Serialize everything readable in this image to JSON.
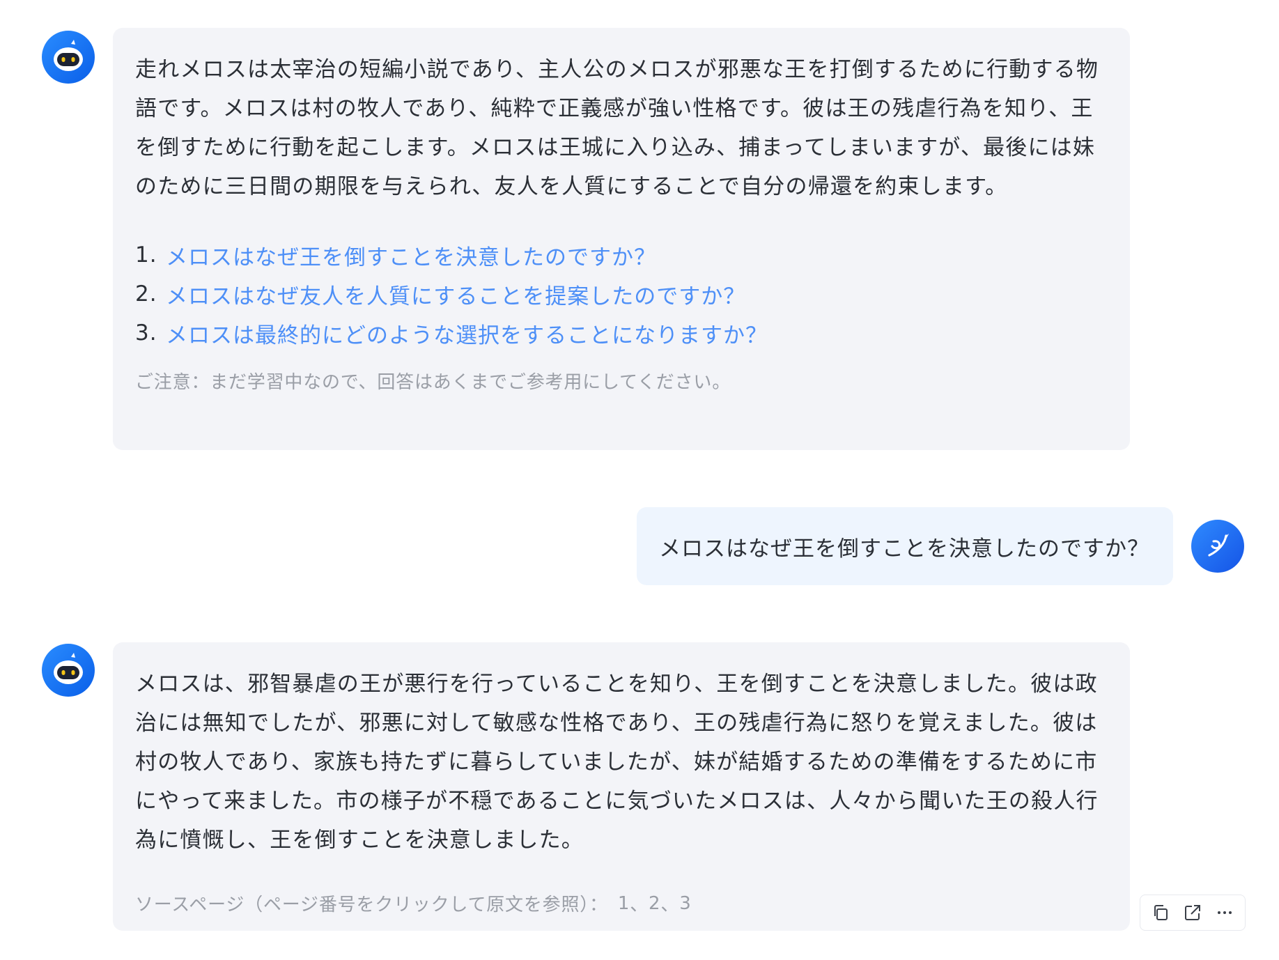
{
  "messages": {
    "bot1": {
      "paragraph": "走れメロスは太宰治の短編小説であり、主人公のメロスが邪悪な王を打倒するために行動する物語です。メロスは村の牧人であり、純粋で正義感が強い性格です。彼は王の残虐行為を知り、王を倒すために行動を起こします。メロスは王城に入り込み、捕まってしまいますが、最後には妹のために三日間の期限を与えられ、友人を人質にすることで自分の帰還を約束します。",
      "suggestions": [
        {
          "num": "1.",
          "text": "メロスはなぜ王を倒すことを決意したのですか？"
        },
        {
          "num": "2.",
          "text": "メロスはなぜ友人を人質にすることを提案したのですか？"
        },
        {
          "num": "3.",
          "text": "メロスは最終的にどのような選択をすることになりますか？"
        }
      ],
      "note": "ご注意：まだ学習中なので、回答はあくまでご参考用にしてください。"
    },
    "user1": {
      "text": "メロスはなぜ王を倒すことを決意したのですか？"
    },
    "bot2": {
      "paragraph": "メロスは、邪智暴虐の王が悪行を行っていることを知り、王を倒すことを決意しました。彼は政治には無知でしたが、邪悪に対して敏感な性格であり、王の残虐行為に怒りを覚えました。彼は村の牧人であり、家族も持たずに暮らしていましたが、妹が結婚するための準備をするために市にやって来ました。市の様子が不穏であることに気づいたメロスは、人々から聞いた王の殺人行為に憤慨し、王を倒すことを決意しました。",
      "source_label": "ソースページ（ページ番号をクリックして原文を参照）：",
      "source_pages": [
        "1",
        "2",
        "3"
      ],
      "source_sep": "、"
    }
  },
  "icons": {
    "bot_avatar": "robot-icon",
    "user_avatar": "bird-icon",
    "copy": "copy-icon",
    "open": "open-external-icon",
    "more": "more-icon"
  },
  "colors": {
    "bot_bubble": "#f3f4f8",
    "user_bubble": "#eef5fe",
    "link": "#4d8ff7",
    "muted": "#9a9ea6",
    "avatar": "#1677ff"
  }
}
